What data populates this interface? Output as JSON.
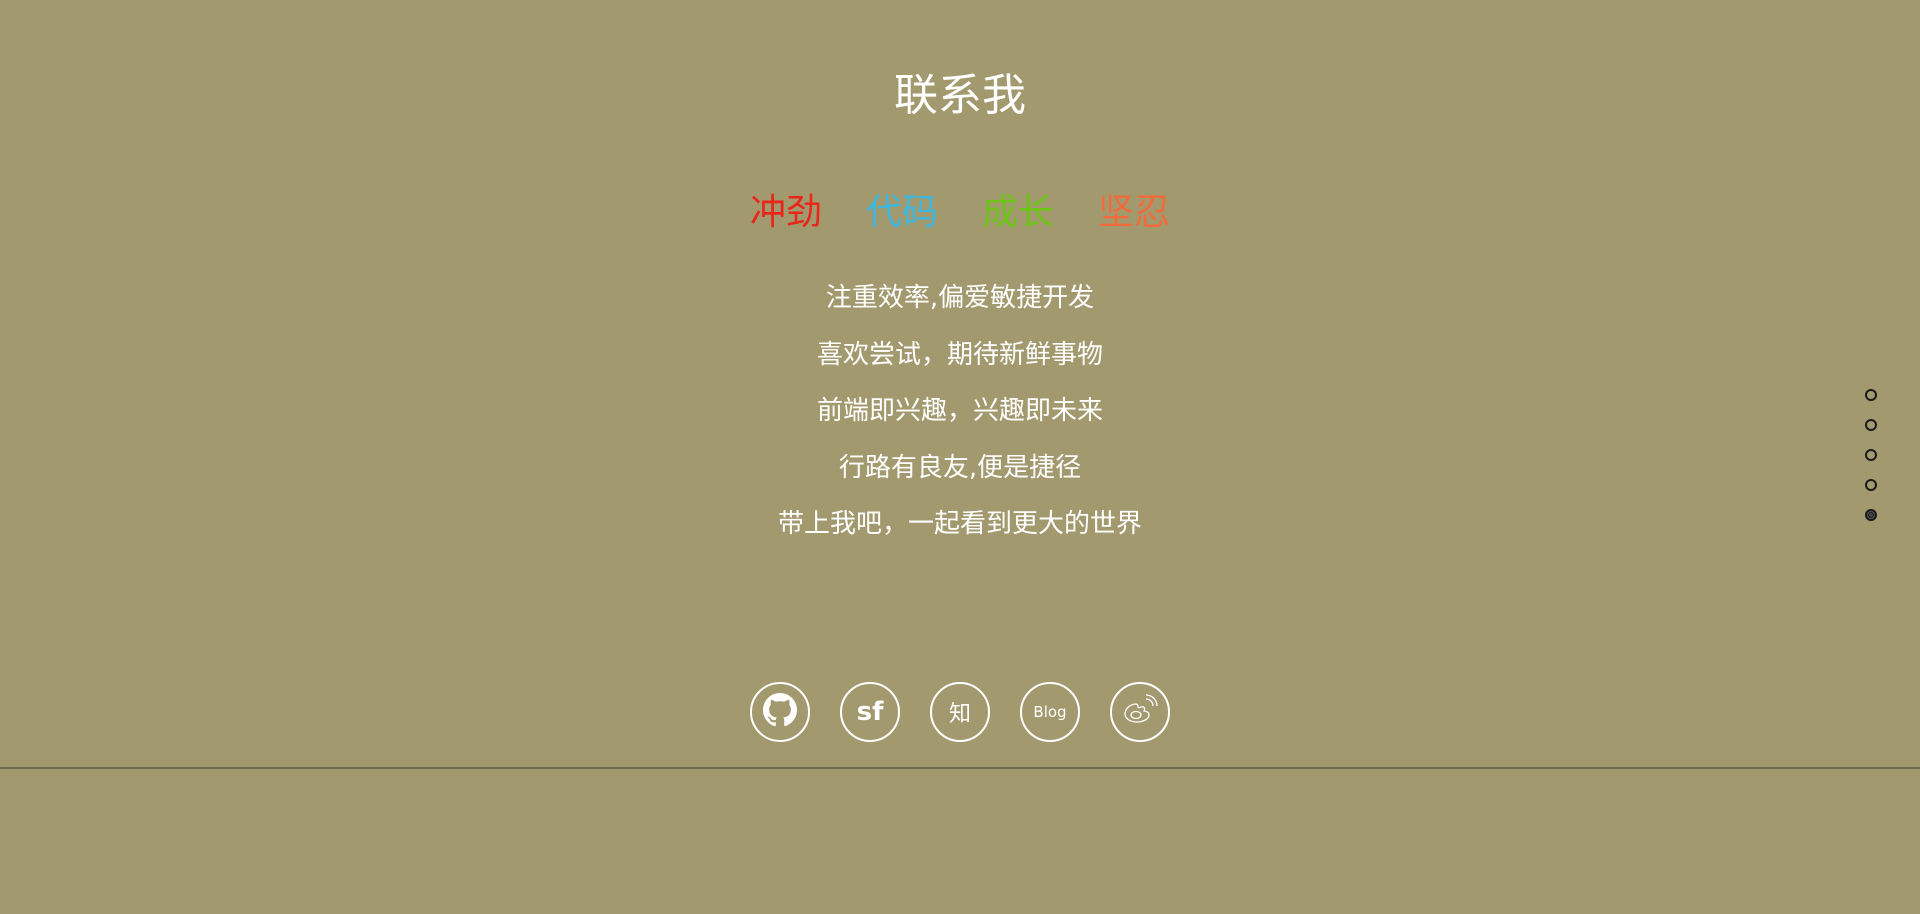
{
  "title": "联系我",
  "keywords": [
    {
      "label": "冲劲",
      "color": "#e8261a"
    },
    {
      "label": "代码",
      "color": "#3fb8e0"
    },
    {
      "label": "成长",
      "color": "#6cc417"
    },
    {
      "label": "坚忍",
      "color": "#f26b3a"
    }
  ],
  "mottos": [
    "注重效率,偏爱敏捷开发",
    "喜欢尝试，期待新鲜事物",
    "前端即兴趣，兴趣即未来",
    "行路有良友,便是捷径",
    "带上我吧，一起看到更大的世界"
  ],
  "socials": [
    {
      "icon": "github-icon"
    },
    {
      "icon": "segmentfault-icon",
      "text": "sf"
    },
    {
      "icon": "zhihu-icon",
      "text": "知"
    },
    {
      "icon": "blog-icon",
      "text": "Blog"
    },
    {
      "icon": "weibo-icon"
    }
  ],
  "nav_dots": {
    "count": 5,
    "active_index": 4
  },
  "colors": {
    "background": "#a3996f",
    "text": "#ffffff",
    "divider": "#6f6a4e"
  }
}
